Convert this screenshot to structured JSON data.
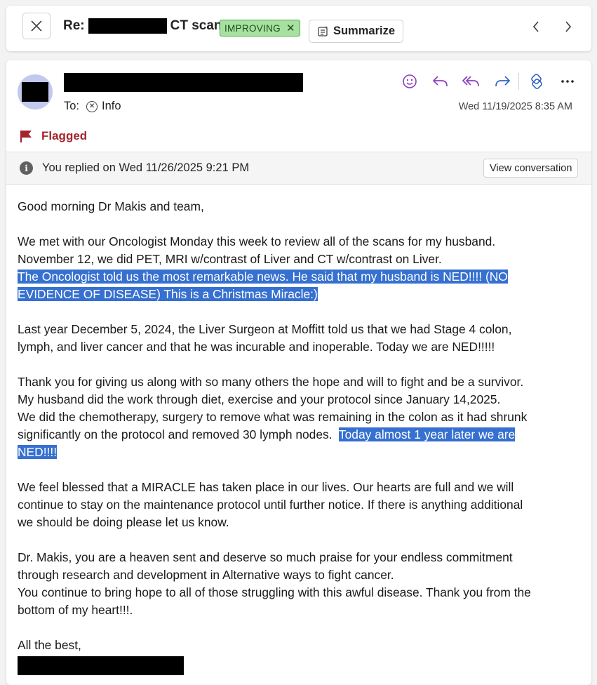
{
  "header": {
    "subject_prefix": "Re:",
    "subject_suffix": "CT scan",
    "tag_label": "IMPROVING",
    "tag_remove": "✕",
    "summarize_label": "Summarize"
  },
  "message": {
    "to_label": "To:",
    "recipient": "Info",
    "date": "Wed 11/19/2025 8:35 AM",
    "flag_label": "Flagged",
    "replied_text": "You replied on Wed 11/26/2025 9:21 PM",
    "view_conversation_label": "View conversation"
  },
  "body": {
    "greeting": "Good morning Dr Makis and team,",
    "p1_l1": "We met with our Oncologist Monday this week to review all of the scans for my husband.",
    "p1_l2": "November 12, we did PET, MRI w/contrast of Liver and CT w/contrast on Liver.",
    "p1_hl1": "The Oncologist told us the most remarkable news.  He said that my husband is NED!!!! (NO",
    "p1_hl2": "EVIDENCE OF DISEASE) This is a Christmas Miracle:)",
    "p2_l1": "Last year December 5, 2024, the Liver Surgeon at Moffitt told us that we had Stage 4 colon,",
    "p2_l2": "lymph, and liver cancer and that he was incurable and inoperable.  Today we are NED!!!!!",
    "p3_l1": "Thank you for giving us along with so many others the hope and will to fight and be a survivor.",
    "p3_l2": "My husband did the work through diet, exercise and your protocol since January 14,2025.",
    "p3_l3": "We did the chemotherapy,  surgery to remove what was remaining in the colon as it had shrunk",
    "p3_l4_plain": "significantly on the protocol and removed 30 lymph nodes.  ",
    "p3_l4_hl": "Today almost 1 year later we are",
    "p3_l5_hl": "NED!!!!",
    "p4_l1": "We feel blessed that a MIRACLE has taken place in our lives. Our hearts are full and we will",
    "p4_l2": "continue to stay on the maintenance protocol until further notice.  If there is anything additional",
    "p4_l3": "we should be doing please let us know.",
    "p5_l1": "Dr. Makis, you are a heaven sent and deserve so much  praise for your endless commitment",
    "p5_l2": "through research and development in Alternative ways to fight cancer.",
    "p5_l3": "You continue to bring hope to all of those struggling with this awful disease.  Thank you from the",
    "p5_l4": "bottom of my heart!!!.",
    "closing": "All the best,"
  },
  "colors": {
    "highlight": "#3670d0",
    "flag": "#a4262c",
    "tag_bg": "#a6e1a0",
    "action_purple": "#8b3fbf",
    "action_blue": "#2e63c4"
  },
  "icons": [
    "close-icon",
    "summarize-icon",
    "chevron-left-icon",
    "chevron-right-icon",
    "emoji-icon",
    "reply-icon",
    "reply-all-icon",
    "forward-icon",
    "loop-icon",
    "more-icon",
    "remove-recipient-icon",
    "flag-icon",
    "info-icon"
  ]
}
